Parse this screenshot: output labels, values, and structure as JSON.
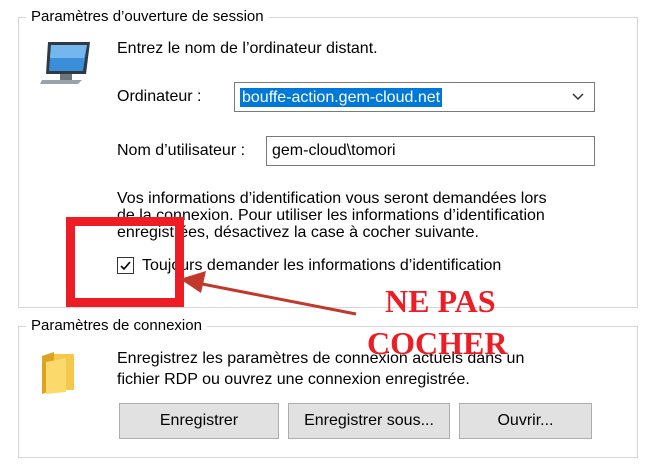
{
  "session_group": {
    "title": "Paramètres d’ouverture de session",
    "intro": "Entrez le nom de l’ordinateur distant.",
    "computer_label": "Ordinateur :",
    "computer_value": "bouffe-action.gem-cloud.net",
    "username_label": "Nom d’utilisateur :",
    "username_value": "gem-cloud\\tomori",
    "info_lines": [
      "Vos informations d’identification vous seront demandées lors",
      "de la connexion. Pour utiliser les informations d’identification",
      "enregistrées, désactivez la case à cocher suivante."
    ],
    "always_ask_label": "Toujours demander les informations d’identification",
    "always_ask_checked": true
  },
  "connection_group": {
    "title": "Paramètres de connexion",
    "desc_lines": [
      "Enregistrez les paramètres de connexion actuels dans un",
      "fichier RDP ou ouvrez une connexion enregistrée."
    ],
    "buttons": {
      "save": "Enregistrer",
      "save_as": "Enregistrer sous...",
      "open": "Ouvrir..."
    }
  },
  "annotation": {
    "line1": "NE PAS",
    "line2": "COCHER",
    "color": "#ee1c24"
  },
  "icons": {
    "monitor": "computer-monitor-icon",
    "folder": "folder-icon",
    "dropdown": "chevron-down-icon",
    "check": "check-icon"
  },
  "colors": {
    "selection": "#0078d7",
    "button_bg": "#e1e1e1",
    "annotation": "#ee1c24"
  }
}
